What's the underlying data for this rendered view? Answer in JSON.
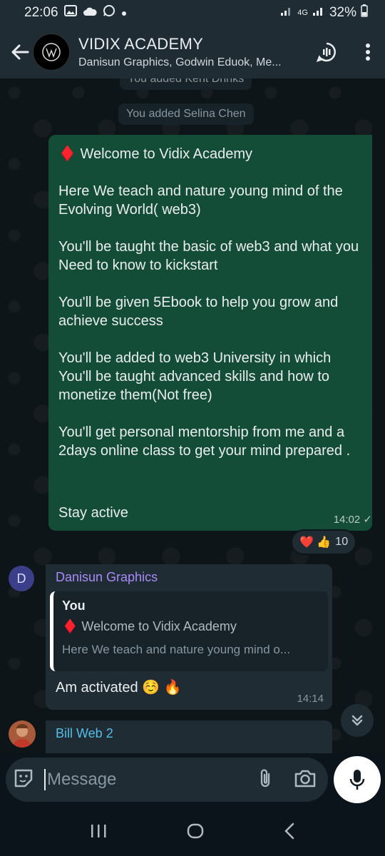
{
  "status_bar": {
    "time": "22:06",
    "battery": "32%",
    "network": "4G"
  },
  "header": {
    "title": "VIDIX ACADEMY",
    "subtitle": "Danisun Graphics, Godwin Eduok, Me..."
  },
  "system_messages": {
    "partial": "You added Kent Drinks",
    "added": "You added Selina Chen"
  },
  "outgoing_message": {
    "line1": "♦️ Welcome to Vidix Academy",
    "p1": "Here We teach and nature young mind of the Evolving World( web3)",
    "p2": "You'll be taught the basic of  web3 and what you Need to know to kickstart",
    "p3": "You'll be given 5Ebook to help you grow and achieve success",
    "p4": "You'll be added to web3 University in which You'll be taught advanced skills and how to monetize them(Not free)",
    "p5": "You'll get personal  mentorship from me and a 2days online class to get your mind prepared .",
    "p6": "Stay active",
    "time": "14:02",
    "reactions": {
      "emojis": "❤️ 👍",
      "count": "10"
    }
  },
  "incoming_message": {
    "avatar_letter": "D",
    "sender": "Danisun Graphics",
    "quote_author": "You",
    "quote_title": "♦️ Welcome to Vidix Academy",
    "quote_body": "Here We teach and nature young mind o...",
    "text": "Am activated ☺️ 🔥",
    "time": "14:14"
  },
  "incoming_message_2": {
    "sender": "Bill Web 2"
  },
  "composer": {
    "placeholder": "Message"
  },
  "colors": {
    "outgoing_bubble": "#144d37",
    "incoming_bubble": "#202c33",
    "header": "#1f2c34"
  }
}
